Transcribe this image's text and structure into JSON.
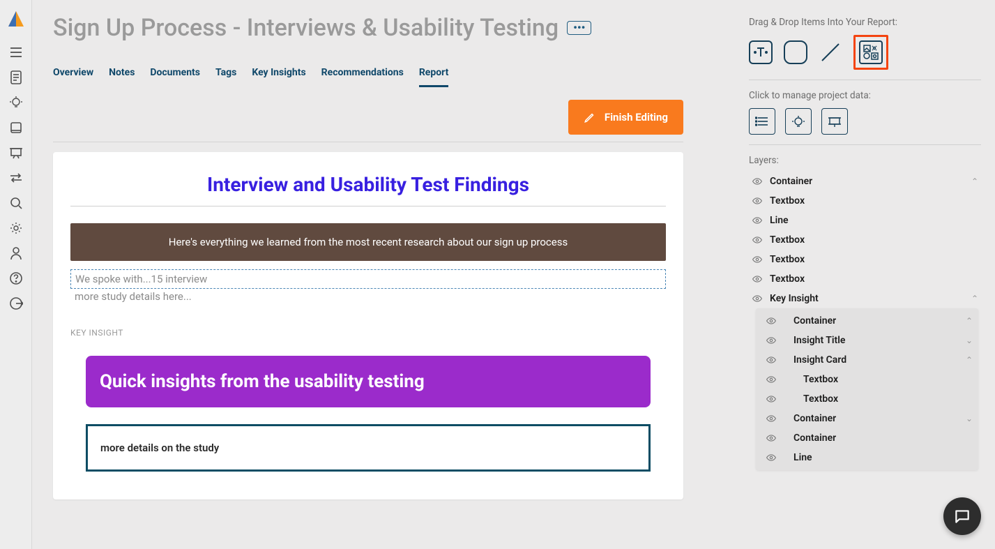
{
  "header": {
    "title": "Sign Up Process - Interviews & Usability Testing",
    "menu_glyph": "•••"
  },
  "tabs": {
    "items": [
      "Overview",
      "Notes",
      "Documents",
      "Tags",
      "Key Insights",
      "Recommendations",
      "Report"
    ],
    "active": "Report"
  },
  "actions": {
    "finish_label": "Finish Editing"
  },
  "report": {
    "h1": "Interview and Usability Test Findings",
    "brown_text": "Here's everything we learned from the most recent research about our sign up process",
    "dashed_text": "We spoke with...15 interview",
    "below_dashed": "more study details here...",
    "key_insight_label": "KEY INSIGHT",
    "purple_text": "Quick insights from the usability testing",
    "detail_text": "more details on the study"
  },
  "right": {
    "drag_label": "Drag & Drop Items Into Your Report:",
    "manage_label": "Click to manage project data:",
    "layers_label": "Layers:",
    "layer_top": [
      {
        "label": "Container",
        "expand": "up"
      },
      {
        "label": "Textbox"
      },
      {
        "label": "Line"
      },
      {
        "label": "Textbox"
      },
      {
        "label": "Textbox"
      },
      {
        "label": "Textbox"
      },
      {
        "label": "Key Insight",
        "expand": "up"
      }
    ],
    "layer_nested": [
      {
        "label": "Container",
        "expand": "up",
        "cls": "sub"
      },
      {
        "label": "Insight Title",
        "expand": "down",
        "cls": "sub"
      },
      {
        "label": "Insight Card",
        "expand": "up",
        "cls": "sub"
      },
      {
        "label": "Textbox",
        "cls": "subsub"
      },
      {
        "label": "Textbox",
        "cls": "subsub"
      },
      {
        "label": "Container",
        "expand": "down",
        "cls": "sub"
      },
      {
        "label": "Container",
        "cls": "sub"
      },
      {
        "label": "Line",
        "cls": "sub"
      }
    ]
  }
}
